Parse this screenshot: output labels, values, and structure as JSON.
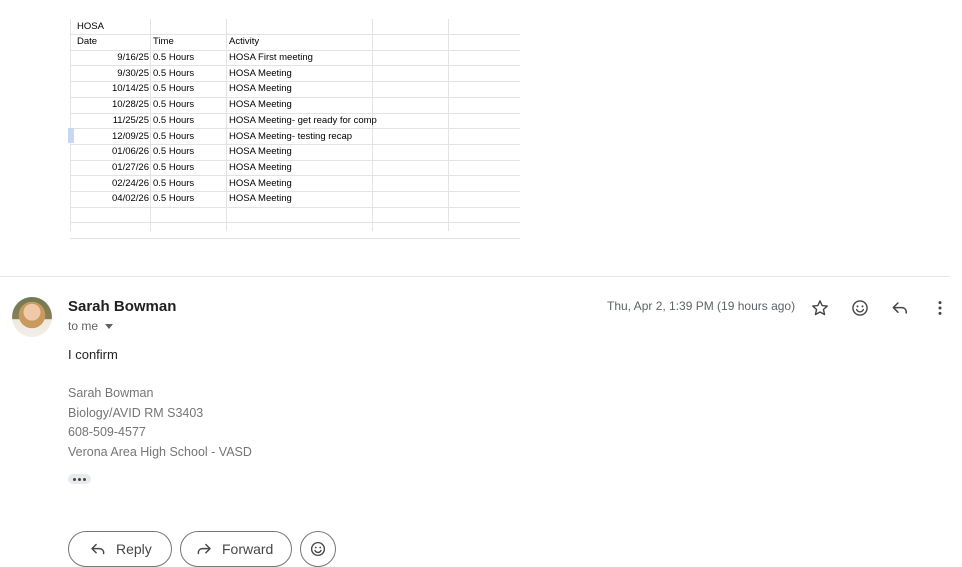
{
  "spreadsheet": {
    "title": "HOSA",
    "headers": {
      "date": "Date",
      "time": "Time",
      "activity": "Activity"
    },
    "rows": [
      {
        "date": "9/16/25",
        "time": "0.5 Hours",
        "activity": "HOSA First meeting"
      },
      {
        "date": "9/30/25",
        "time": "0.5 Hours",
        "activity": "HOSA Meeting"
      },
      {
        "date": "10/14/25",
        "time": "0.5 Hours",
        "activity": "HOSA Meeting"
      },
      {
        "date": "10/28/25",
        "time": "0.5 Hours",
        "activity": "HOSA Meeting"
      },
      {
        "date": "11/25/25",
        "time": "0.5 Hours",
        "activity": "HOSA Meeting- get ready for comp"
      },
      {
        "date": "12/09/25",
        "time": "0.5 Hours",
        "activity": "HOSA Meeting- testing recap"
      },
      {
        "date": "01/06/26",
        "time": "0.5 Hours",
        "activity": "HOSA Meeting"
      },
      {
        "date": "01/27/26",
        "time": "0.5 Hours",
        "activity": "HOSA Meeting"
      },
      {
        "date": "02/24/26",
        "time": "0.5 Hours",
        "activity": "HOSA Meeting"
      },
      {
        "date": "04/02/26",
        "time": "0.5 Hours",
        "activity": "HOSA Meeting"
      }
    ]
  },
  "message": {
    "sender": "Sarah Bowman",
    "recipient_label": "to me",
    "date": "Thu, Apr 2, 1:39 PM (19 hours ago)",
    "body": "I confirm",
    "signature": [
      "Sarah Bowman",
      "Biology/AVID RM S3403",
      "608-509-4577",
      "Verona Area High School - VASD"
    ],
    "header_icons": [
      "star-icon",
      "emoji-reaction-icon",
      "reply-icon",
      "more-vert-icon"
    ]
  },
  "actions": {
    "reply_label": "Reply",
    "forward_label": "Forward"
  }
}
